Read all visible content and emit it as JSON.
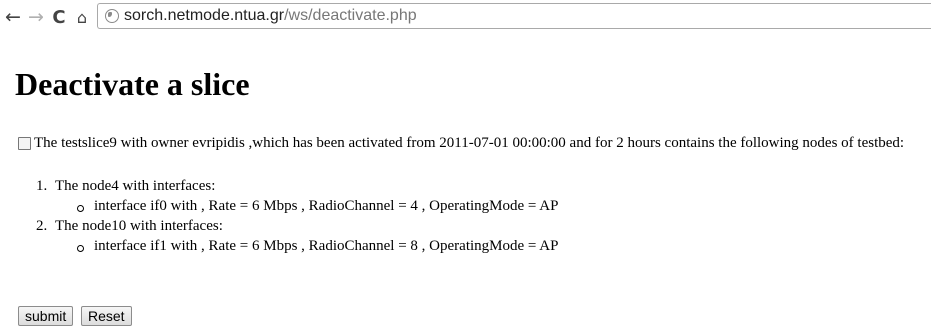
{
  "browser": {
    "url_host": "sorch.netmode.ntua.gr",
    "url_path": "/ws/deactivate.php"
  },
  "page": {
    "title": "Deactivate a slice",
    "slice_description": "The testslice9 with owner evripidis ,which has been activated from 2011-07-01 00:00:00 and for 2 hours contains the following nodes of testbed:",
    "nodes": [
      {
        "number": "1.",
        "label": "The node4 with interfaces:",
        "interfaces": [
          "interface if0 with , Rate = 6 Mbps , RadioChannel = 4 , OperatingMode = AP"
        ]
      },
      {
        "number": "2.",
        "label": "The node10 with interfaces:",
        "interfaces": [
          "interface if1 with , Rate = 6 Mbps , RadioChannel = 8 , OperatingMode = AP"
        ]
      }
    ],
    "submit_label": "submit",
    "reset_label": "Reset"
  },
  "icons": {
    "back": "back-arrow-icon",
    "forward": "forward-arrow-icon",
    "reload": "reload-icon",
    "home": "home-icon",
    "site": "globe-icon"
  }
}
